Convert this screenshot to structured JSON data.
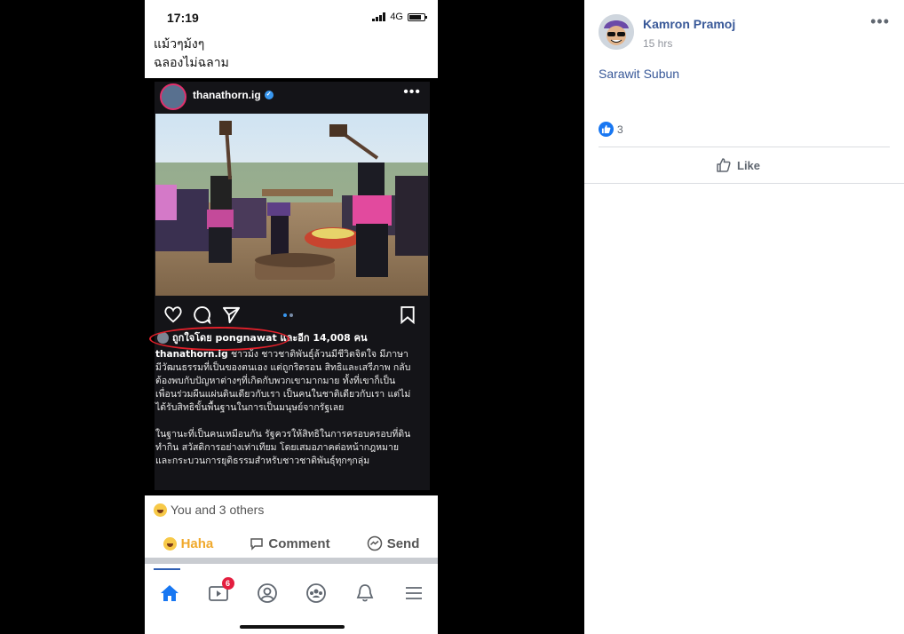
{
  "phone": {
    "status": {
      "time": "17:19",
      "network": "4G"
    },
    "post_text": [
      "แม้วๆม้งๆ",
      "ฉลองไม่ฉลาม"
    ],
    "instagram": {
      "username": "thanathorn.ig",
      "liked_by": "ถูกใจโดย pongnawat และอีก 14,008 คน",
      "caption_user": "thanathorn.ig",
      "caption_p1": "ชาวม้ง ชาวชาติพันธุ์ล้วนมีชีวิตจิตใจ มีภาษา มีวัฒนธรรมที่เป็นของตนเอง แต่ถูกริดรอน สิทธิและเสรีภาพ กลับต้องพบกับปัญหาต่างๆที่เกิดกับพวกเขามากมาย ทั้งที่เขาก็เป็นเพื่อนร่วมผืนแผ่นดินเดียวกับเรา เป็นคนในชาติเดียวกับเรา แต่ไม่ได้รับสิทธิขั้นพื้นฐานในการเป็นมนุษย์จากรัฐเลย",
      "caption_p2": "ในฐานะที่เป็นคนเหมือนกัน รัฐควรให้สิทธิในการครอบครอบที่ดินทำกิน สวัสดิการอย่างเท่าเทียม โดยเสมอภาคต่อหน้ากฎหมายและกระบวนการยุติธรรมสำหรับชาวชาติพันธุ์ทุกๆกลุ่ม"
    },
    "reactions_text": "You and 3 others",
    "actions": {
      "haha": "Haha",
      "comment": "Comment",
      "send": "Send"
    },
    "tabbar": {
      "video_badge": "6"
    }
  },
  "panel": {
    "author": "Kamron Pramoj",
    "time": "15 hrs",
    "tagged": "Sarawit Subun",
    "like_count": "3",
    "like_label": "Like"
  },
  "colors": {
    "fb_blue": "#385898",
    "haha_yellow": "#f0a92c",
    "badge_red": "#e41e3f",
    "oval_red": "#e0202a"
  }
}
